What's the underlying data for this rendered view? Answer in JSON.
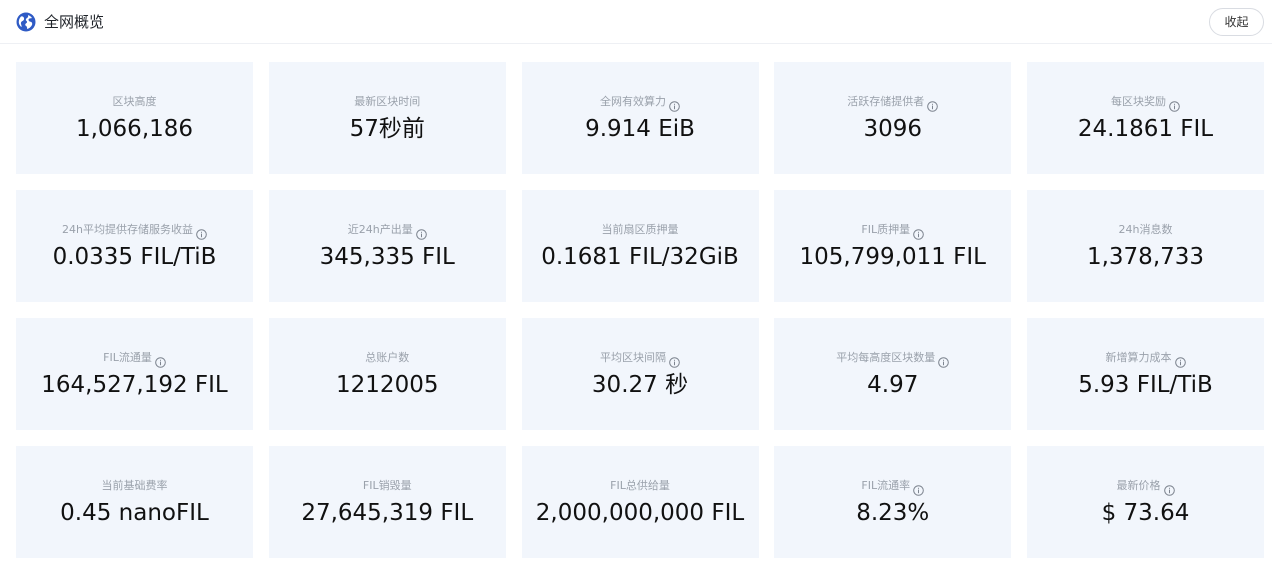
{
  "header": {
    "title": "全网概览",
    "collapse_label": "收起",
    "logo_icon": "globe-icon",
    "accent": "#2f5bc5"
  },
  "cards": [
    {
      "label": "区块高度",
      "value": "1,066,186",
      "info": false
    },
    {
      "label": "最新区块时间",
      "value": "57秒前",
      "info": false
    },
    {
      "label": "全网有效算力",
      "value": "9.914 EiB",
      "info": true
    },
    {
      "label": "活跃存储提供者",
      "value": "3096",
      "info": true
    },
    {
      "label": "每区块奖励",
      "value": "24.1861 FIL",
      "info": true
    },
    {
      "label": "24h平均提供存储服务收益",
      "value": "0.0335 FIL/TiB",
      "info": true
    },
    {
      "label": "近24h产出量",
      "value": "345,335 FIL",
      "info": true
    },
    {
      "label": "当前扇区质押量",
      "value": "0.1681 FIL/32GiB",
      "info": false
    },
    {
      "label": "FIL质押量",
      "value": "105,799,011 FIL",
      "info": true
    },
    {
      "label": "24h消息数",
      "value": "1,378,733",
      "info": false
    },
    {
      "label": "FIL流通量",
      "value": "164,527,192 FIL",
      "info": true
    },
    {
      "label": "总账户数",
      "value": "1212005",
      "info": false
    },
    {
      "label": "平均区块间隔",
      "value": "30.27 秒",
      "info": true
    },
    {
      "label": "平均每高度区块数量",
      "value": "4.97",
      "info": true
    },
    {
      "label": "新增算力成本",
      "value": "5.93 FIL/TiB",
      "info": true
    },
    {
      "label": "当前基础费率",
      "value": "0.45 nanoFIL",
      "info": false
    },
    {
      "label": "FIL销毁量",
      "value": "27,645,319 FIL",
      "info": false
    },
    {
      "label": "FIL总供给量",
      "value": "2,000,000,000 FIL",
      "info": false
    },
    {
      "label": "FIL流通率",
      "value": "8.23%",
      "info": true
    },
    {
      "label": "最新价格",
      "value": "$ 73.64",
      "info": true
    }
  ],
  "colors": {
    "card_background": "#f2f6fc",
    "label_text": "#9aa1ab",
    "value_text": "#111111"
  },
  "icons": {
    "info": "info-circle-icon"
  }
}
